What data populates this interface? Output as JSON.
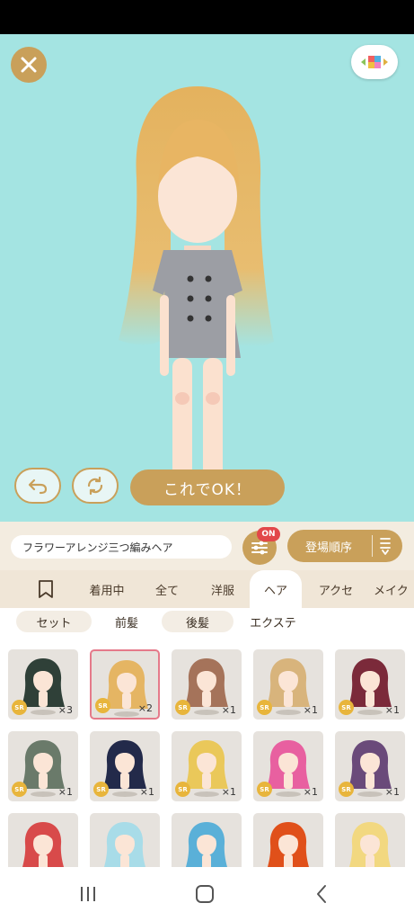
{
  "ok_label": "これでOK！",
  "item_name": "フラワーアレンジ三つ編みヘア",
  "filter_badge": "ON",
  "sort_label": "登場順序",
  "colors": {
    "stage": "#a4e4e2",
    "gold": "#c9a05a",
    "badge": "#e2474a",
    "sr": "#e8b53c",
    "selected": "#e57a8a"
  },
  "tabs": [
    {
      "label": "",
      "icon": "bookmark-icon"
    },
    {
      "label": "着用中"
    },
    {
      "label": "全て"
    },
    {
      "label": "洋服"
    },
    {
      "label": "ヘア",
      "active": true
    },
    {
      "label": "アクセ"
    },
    {
      "label": "メイク"
    }
  ],
  "subtabs": [
    {
      "label": "セット"
    },
    {
      "label": "前髪"
    },
    {
      "label": "後髪"
    },
    {
      "label": "エクステ"
    }
  ],
  "items": [
    {
      "rarity": "SR",
      "count": "×3",
      "hair": "#2f4038"
    },
    {
      "rarity": "SR",
      "count": "×2",
      "hair": "#e5b563",
      "selected": true
    },
    {
      "rarity": "SR",
      "count": "×1",
      "hair": "#a5735a"
    },
    {
      "rarity": "SR",
      "count": "×1",
      "hair": "#d8b47c"
    },
    {
      "rarity": "SR",
      "count": "×1",
      "hair": "#7b2a3a"
    },
    {
      "rarity": "SR",
      "count": "×1",
      "hair": "#6a7a6a"
    },
    {
      "rarity": "SR",
      "count": "×1",
      "hair": "#232a4a"
    },
    {
      "rarity": "SR",
      "count": "×1",
      "hair": "#eac85a"
    },
    {
      "rarity": "SR",
      "count": "×1",
      "hair": "#e860a0"
    },
    {
      "rarity": "SR",
      "count": "×1",
      "hair": "#6a4a7a"
    },
    {
      "rarity": "",
      "count": "",
      "hair": "#d84a4a"
    },
    {
      "rarity": "",
      "count": "",
      "hair": "#a8dce8"
    },
    {
      "rarity": "",
      "count": "",
      "hair": "#5ab0d8"
    },
    {
      "rarity": "",
      "count": "",
      "hair": "#e0501a"
    },
    {
      "rarity": "",
      "count": "",
      "hair": "#f2d880"
    }
  ]
}
